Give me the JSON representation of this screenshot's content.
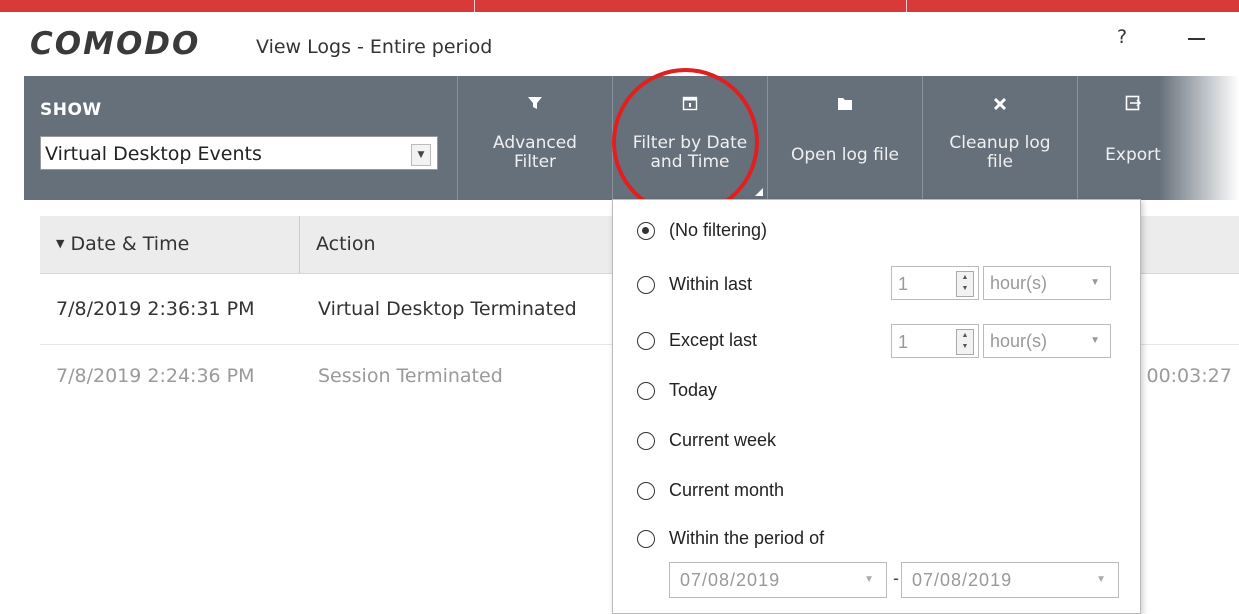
{
  "app": {
    "logo": "COMODO",
    "title": "View Logs - Entire period",
    "help": "?"
  },
  "show": {
    "label": "SHOW",
    "selected": "Virtual Desktop Events"
  },
  "toolbar": {
    "advanced_filter": "Advanced Filter",
    "filter_date": "Filter by Date and Time",
    "open_log": "Open log file",
    "cleanup": "Cleanup log file",
    "export": "Export"
  },
  "table": {
    "columns": [
      "Date & Time",
      "Action"
    ],
    "rows": [
      {
        "date": "7/8/2019 2:36:31 PM",
        "action": "Virtual Desktop Terminated",
        "extra": ""
      },
      {
        "date": "7/8/2019 2:24:36 PM",
        "action": "Session Terminated",
        "extra": "n: 00:03:27"
      }
    ]
  },
  "date_filter": {
    "options": [
      "(No filtering)",
      "Within last",
      "Except last",
      "Today",
      "Current week",
      "Current month",
      "Within the period of"
    ],
    "selected_index": 0,
    "within_last": {
      "value": "1",
      "unit": "hour(s)"
    },
    "except_last": {
      "value": "1",
      "unit": "hour(s)"
    },
    "period": {
      "from": "07/08/2019",
      "separator": "-",
      "to": "07/08/2019"
    }
  },
  "icons": {
    "advanced_filter": "funnel-icon",
    "filter_date": "calendar-icon",
    "open_log": "folder-icon",
    "cleanup": "x-icon",
    "export": "export-icon"
  },
  "colors": {
    "topbar": "#d83a3a",
    "toolbar": "#66707b",
    "highlight": "#e02020"
  }
}
